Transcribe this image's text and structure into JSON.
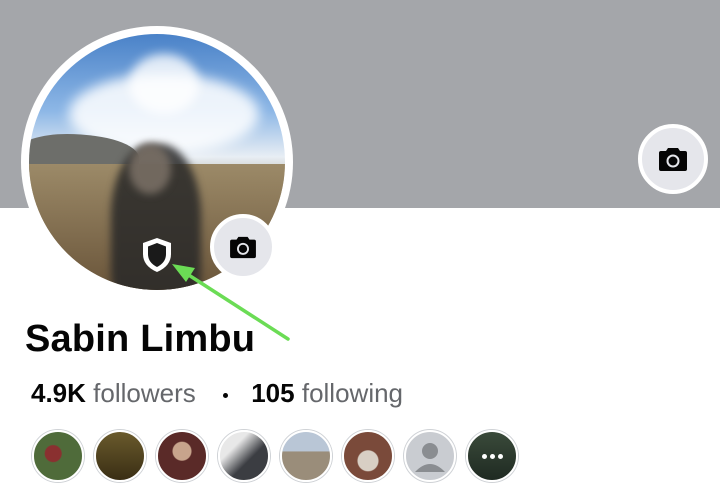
{
  "profile": {
    "name": "Sabin Limbu",
    "followers_count": "4.9K",
    "followers_label": "followers",
    "following_count": "105",
    "following_label": "following"
  },
  "icons": {
    "cover_camera": "camera-icon",
    "avatar_camera": "camera-icon",
    "profile_guard": "shield-icon",
    "more_friends": "more-dots-icon"
  },
  "friends": [
    {
      "name": "friend-1",
      "color": "#4f6b3a"
    },
    {
      "name": "friend-2",
      "color": "#6a5a2c"
    },
    {
      "name": "friend-3",
      "color": "#5a2a28"
    },
    {
      "name": "friend-4",
      "color": "#3b3d42"
    },
    {
      "name": "friend-5",
      "color": "#9a8d7a"
    },
    {
      "name": "friend-6",
      "color": "#7a4a3a"
    },
    {
      "name": "friend-7",
      "color": "#c9ccd1"
    },
    {
      "name": "friend-8",
      "color": "#2e3a2e"
    }
  ],
  "colors": {
    "cover": "#a4a6aa",
    "camera_button": "#e5e6eb",
    "arrow": "#6bdc55",
    "secondary_text": "#65676b"
  }
}
